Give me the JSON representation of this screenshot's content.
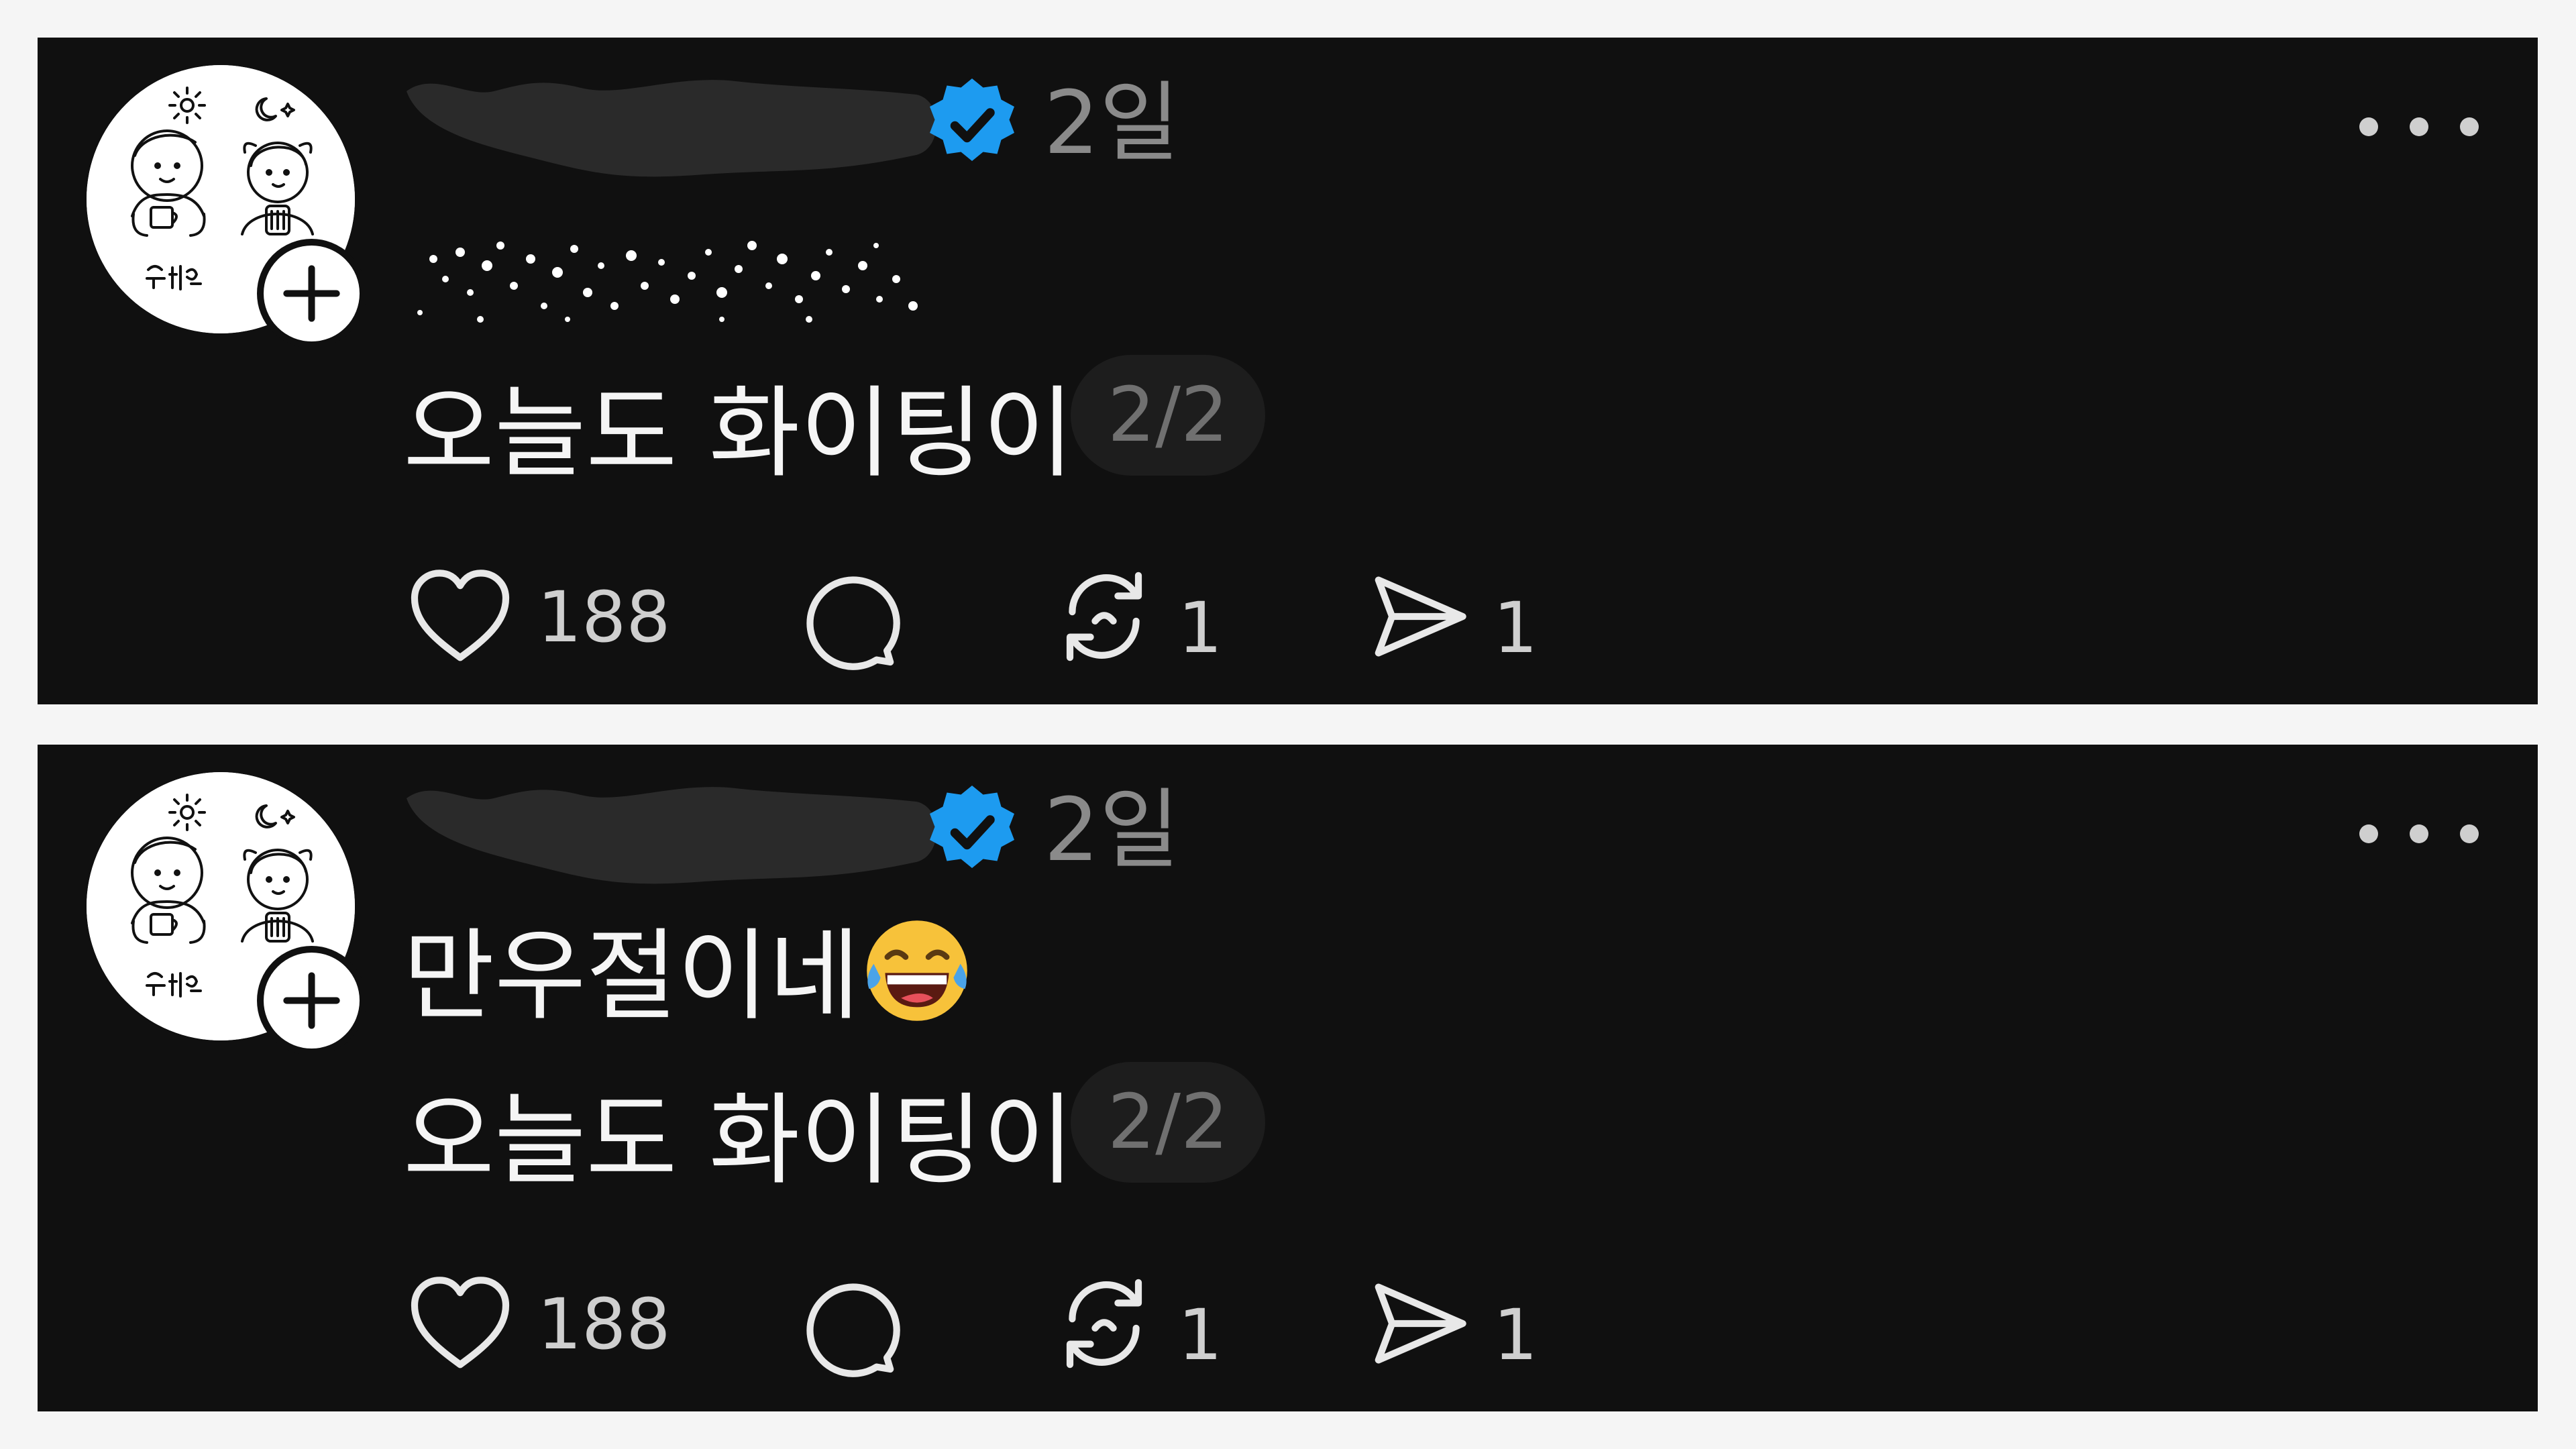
{
  "colors": {
    "background": "#f5f5f5",
    "card": "#101010",
    "text": "#f5f5f5",
    "muted": "#8a8a8a",
    "verified": "#1d9bf0",
    "badge_bg": "#1d1d1d"
  },
  "posts": [
    {
      "avatar_icon": "avatar-illustration",
      "follow_icon": "plus-icon",
      "verified_icon": "verified-badge-icon",
      "time": "2일",
      "more_icon": "more-dots-icon",
      "line2": "오늘도 화이팅이야",
      "counter": "2/2",
      "likes": "188",
      "reposts": "1",
      "shares": "1"
    },
    {
      "avatar_icon": "avatar-illustration",
      "follow_icon": "plus-icon",
      "verified_icon": "verified-badge-icon",
      "time": "2일",
      "more_icon": "more-dots-icon",
      "line1": "만우절이네",
      "line1_emoji": "face-with-tears-of-joy",
      "line2": "오늘도 화이팅이야",
      "counter": "2/2",
      "likes": "188",
      "reposts": "1",
      "shares": "1"
    }
  ]
}
